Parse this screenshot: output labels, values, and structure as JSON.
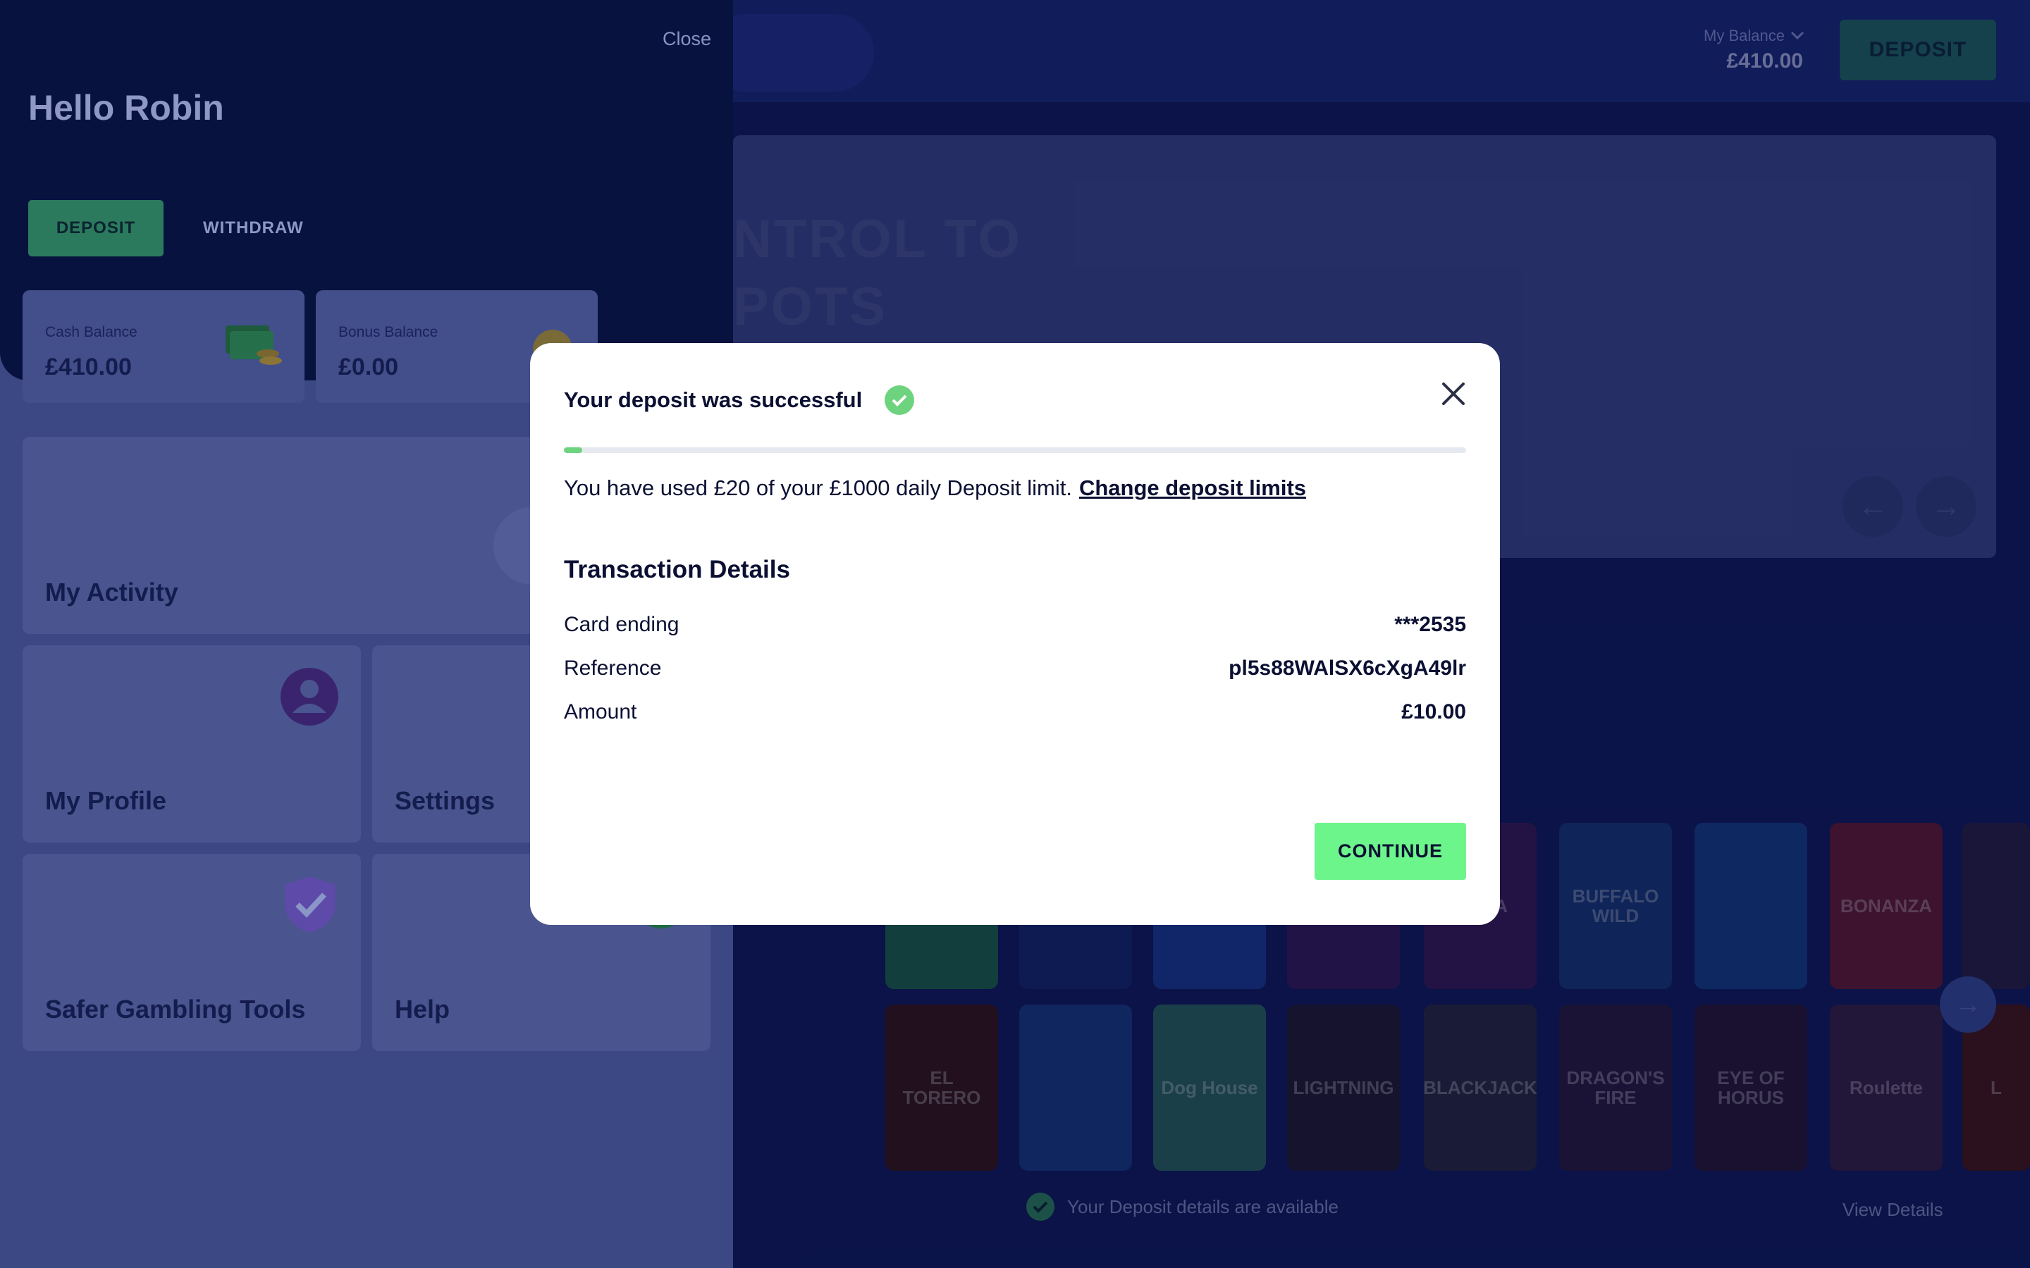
{
  "header": {
    "balance_label": "My Balance",
    "balance_value": "£410.00",
    "deposit_label": "DEPOSIT"
  },
  "hero": {
    "text": "NTROL TO\nPOTS",
    "prev_icon": "arrow-left-icon",
    "next_icon": "arrow-right-icon"
  },
  "games": {
    "row1": [
      "",
      "",
      "",
      "",
      "MEGA",
      "BUFFALO WILD",
      "",
      "BONANZA",
      ""
    ],
    "row2": [
      "EL TORERO",
      "",
      "Dog House",
      "LIGHTNING",
      "BLACKJACK",
      "DRAGON'S FIRE",
      "EYE OF HORUS",
      "Roulette",
      "L"
    ]
  },
  "notice": {
    "text": "Your Deposit details are available",
    "link": "View Details"
  },
  "drawer": {
    "close_label": "Close",
    "greeting": "Hello Robin",
    "tabs": {
      "deposit": "DEPOSIT",
      "withdraw": "WITHDRAW"
    },
    "cash_balance": {
      "label": "Cash Balance",
      "value": "£410.00"
    },
    "bonus_balance": {
      "label": "Bonus Balance",
      "value": "£0.00"
    },
    "menu": {
      "activity": "My Activity",
      "profile": "My Profile",
      "settings": "Settings",
      "safer_gambling": "Safer Gambling Tools",
      "help": "Help"
    }
  },
  "modal": {
    "title": "Your deposit was successful",
    "limit_used_fraction": 0.02,
    "limit_text": "You have used £20 of your £1000 daily Deposit limit.",
    "limit_link": "Change deposit limits",
    "section_title": "Transaction Details",
    "rows": [
      {
        "label": "Card ending",
        "value": "***2535"
      },
      {
        "label": "Reference",
        "value": "pl5s88WAlSX6cXgA49lr"
      },
      {
        "label": "Amount",
        "value": "£10.00"
      }
    ],
    "continue_label": "CONTINUE"
  },
  "colors": {
    "accent_green": "#6cf58b",
    "success_green": "#6ed37e",
    "drawer_bg": "#07123f",
    "text_dark": "#0b1033"
  }
}
